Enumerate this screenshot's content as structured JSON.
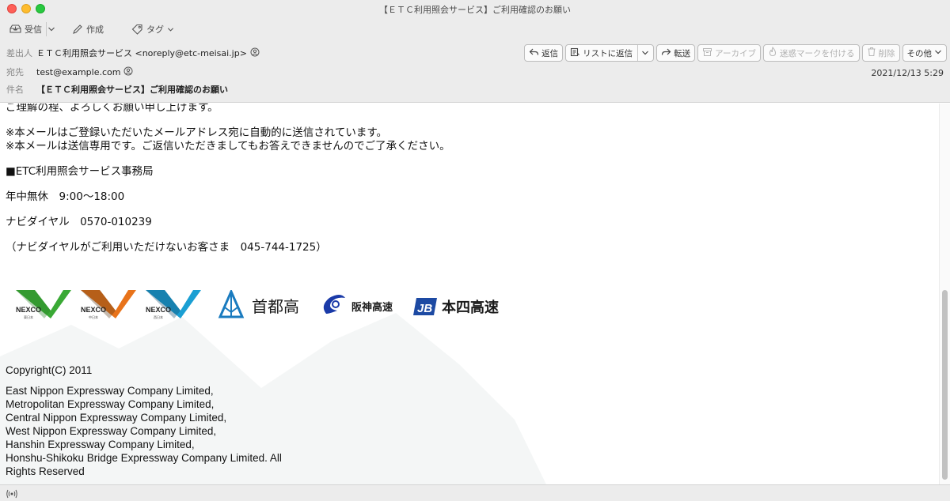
{
  "window": {
    "title": "【ＥＴＣ利用照会サービス】ご利用確認のお願い"
  },
  "toolbar": {
    "inbox_label": "受信",
    "compose_label": "作成",
    "tag_label": "タグ"
  },
  "header": {
    "from_label": "差出人",
    "from_value": "ＥＴＣ利用照会サービス <noreply@etc-meisai.jp>",
    "to_label": "宛先",
    "to_value": "test@example.com",
    "subject_label": "件名",
    "subject_value": "【ＥＴＣ利用照会サービス】ご利用確認のお願い",
    "date": "2021/12/13 5:29",
    "actions": {
      "reply": "返信",
      "reply_list": "リストに返信",
      "forward": "転送",
      "archive": "アーカイブ",
      "junk": "迷惑マークを付ける",
      "delete": "削除",
      "other": "その他"
    }
  },
  "body": {
    "line1": "ご理解の程、よろしくお願い申し上げます。",
    "note1": "※本メールはご登録いただいたメールアドレス宛に自動的に送信されています。",
    "note2": "※本メールは送信専用です。ご返信いただきましてもお答えできませんのでご了承ください。",
    "office": "■ETC利用照会サービス事務局",
    "hours": "年中無休　9:00〜18:00",
    "navi": "ナビダイヤル　0570-010239",
    "alt": "（ナビダイヤルがご利用いただけないお客さま　045-744-1725）",
    "copyright": "Copyright(C) 2011",
    "companies": [
      "East Nippon Expressway Company Limited,",
      "Metropolitan Expressway Company Limited,",
      "Central Nippon Expressway Company Limited,",
      "West Nippon Expressway Company Limited,",
      "Hanshin Expressway Company Limited,",
      "Honshu-Shikoku Bridge Expressway Company Limited. All",
      "Rights Reserved"
    ]
  },
  "logos": {
    "nexco_text": "NEXCO",
    "nexco_east_sub": "東日本",
    "nexco_central_sub": "中日本",
    "nexco_west_sub": "西日本",
    "shutoko": "首都高",
    "hanshin": "阪神高速",
    "honshi_mark": "JB",
    "honshi": "本四高速"
  },
  "colors": {
    "nexco_east": "#3aa935",
    "nexco_central": "#e8731a",
    "nexco_west": "#1a9fd3",
    "shutoko": "#1a7bbf",
    "hanshin": "#1a3aa8",
    "honshi": "#1d4aa3"
  }
}
